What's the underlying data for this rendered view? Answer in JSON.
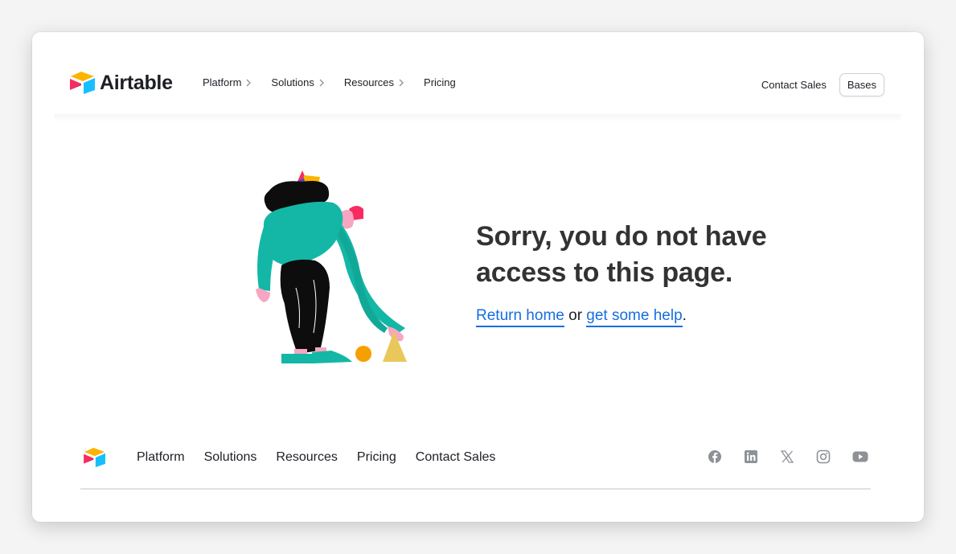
{
  "brand": {
    "name": "Airtable"
  },
  "header": {
    "nav": [
      {
        "label": "Platform",
        "has_chevron": true
      },
      {
        "label": "Solutions",
        "has_chevron": true
      },
      {
        "label": "Resources",
        "has_chevron": true
      },
      {
        "label": "Pricing",
        "has_chevron": false
      }
    ],
    "contact_label": "Contact Sales",
    "bases_label": "Bases"
  },
  "main": {
    "headline_line1": "Sorry, you do not have",
    "headline_line2": "access to this page.",
    "return_home": "Return home",
    "or_text": " or ",
    "get_help": "get some help",
    "period": "."
  },
  "footer": {
    "nav": [
      "Platform",
      "Solutions",
      "Resources",
      "Pricing",
      "Contact Sales"
    ],
    "social_icons": [
      "facebook-icon",
      "linkedin-icon",
      "x-icon",
      "instagram-icon",
      "youtube-icon"
    ]
  },
  "colors": {
    "link": "#166ee1",
    "logo_yellow": "#fcb400",
    "logo_red": "#f82b60",
    "logo_blue": "#18bfff",
    "social_gray": "#8e9196"
  }
}
